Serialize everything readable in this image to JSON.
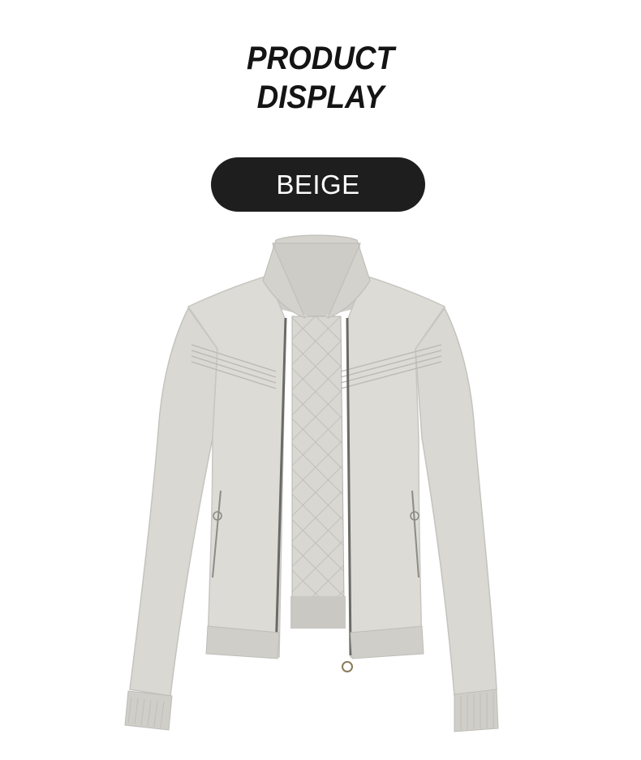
{
  "heading": {
    "line1": "PRODUCT",
    "line2": "DISPLAY"
  },
  "color_badge": {
    "label": "BEIGE"
  },
  "product_image": {
    "subject": "beige quilted-lined bomber jacket",
    "colors": {
      "fabric": "#dcdbd6",
      "shadow": "#c2c1bc",
      "rib": "#d0cfca",
      "lining": "#d6d5d0",
      "zipper": "#6a6a66"
    }
  }
}
